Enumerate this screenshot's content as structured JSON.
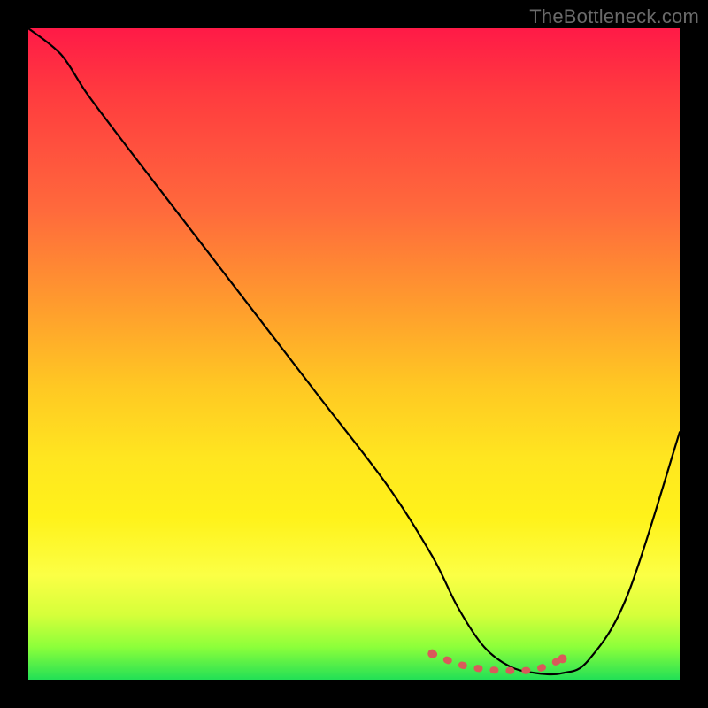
{
  "watermark": "TheBottleneck.com",
  "colors": {
    "frame": "#000000",
    "curve": "#000000",
    "marker": "#d95a5a",
    "gradient_top": "#ff1a47",
    "gradient_bottom": "#22e056"
  },
  "chart_data": {
    "type": "line",
    "title": "",
    "xlabel": "",
    "ylabel": "",
    "xlim": [
      0,
      100
    ],
    "ylim": [
      0,
      100
    ],
    "grid": false,
    "legend": false,
    "note": "Visual bottleneck curve. No axis ticks or labels are shown; values are estimated proportionally from pixel positions (0–100 on both axes).",
    "series": [
      {
        "name": "bottleneck-curve",
        "x": [
          0,
          5,
          9,
          15,
          25,
          35,
          45,
          55,
          62,
          66,
          70,
          74,
          78,
          82,
          86,
          92,
          100
        ],
        "y": [
          100,
          96,
          90,
          82,
          69,
          56,
          43,
          30,
          19,
          11,
          5,
          2,
          1,
          1,
          3,
          13,
          38
        ]
      }
    ],
    "highlight": {
      "name": "optimal-range",
      "description": "Dotted red segment marking the flat bottom of the curve (minimal bottleneck).",
      "x": [
        62,
        66,
        70,
        74,
        78,
        82
      ],
      "y": [
        4,
        2.4,
        1.6,
        1.4,
        1.6,
        3.2
      ]
    }
  }
}
